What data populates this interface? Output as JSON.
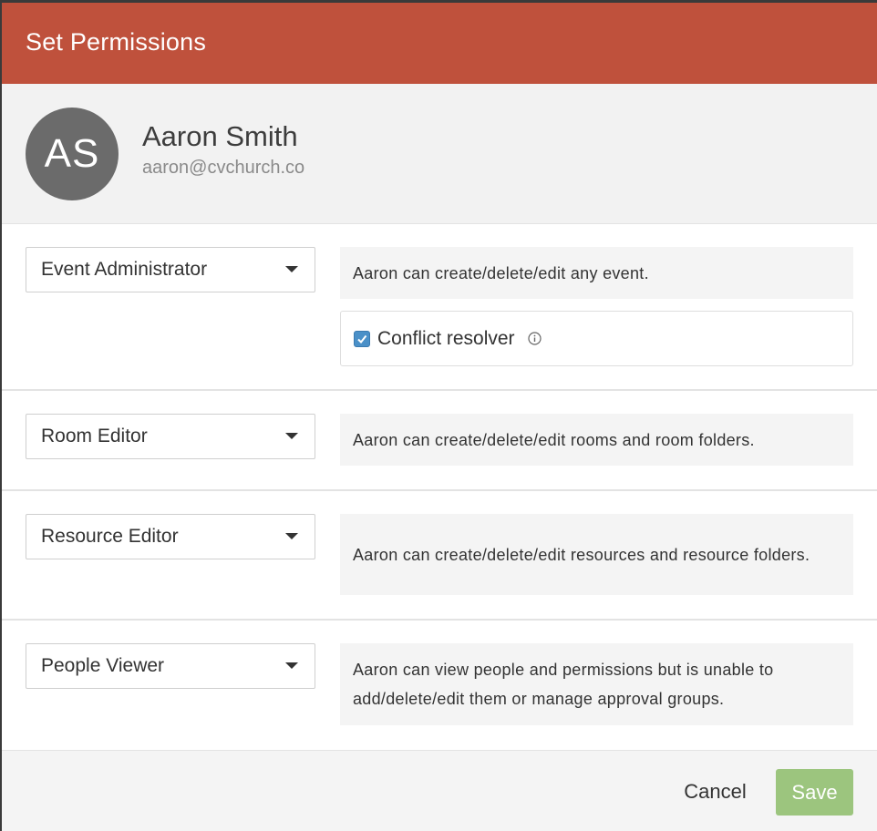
{
  "modal": {
    "title": "Set Permissions"
  },
  "user": {
    "initials": "AS",
    "name": "Aaron Smith",
    "email": "aaron@cvchurch.co"
  },
  "permissions": [
    {
      "role": "Event Administrator",
      "description": "Aaron can create/delete/edit any event.",
      "option": {
        "label": "Conflict resolver",
        "checked": true,
        "icon": "info-icon"
      }
    },
    {
      "role": "Room Editor",
      "description": "Aaron can create/delete/edit rooms and room folders."
    },
    {
      "role": "Resource Editor",
      "description": "Aaron can create/delete/edit resources and resource folders."
    },
    {
      "role": "People Viewer",
      "description": "Aaron can view people and permissions but is unable to add/delete/edit them or manage approval groups."
    }
  ],
  "footer": {
    "cancel_label": "Cancel",
    "save_label": "Save"
  },
  "colors": {
    "header": "#bf513c",
    "save": "#9cc57e",
    "checkbox": "#4a90c8",
    "avatar": "#6b6b6b"
  }
}
